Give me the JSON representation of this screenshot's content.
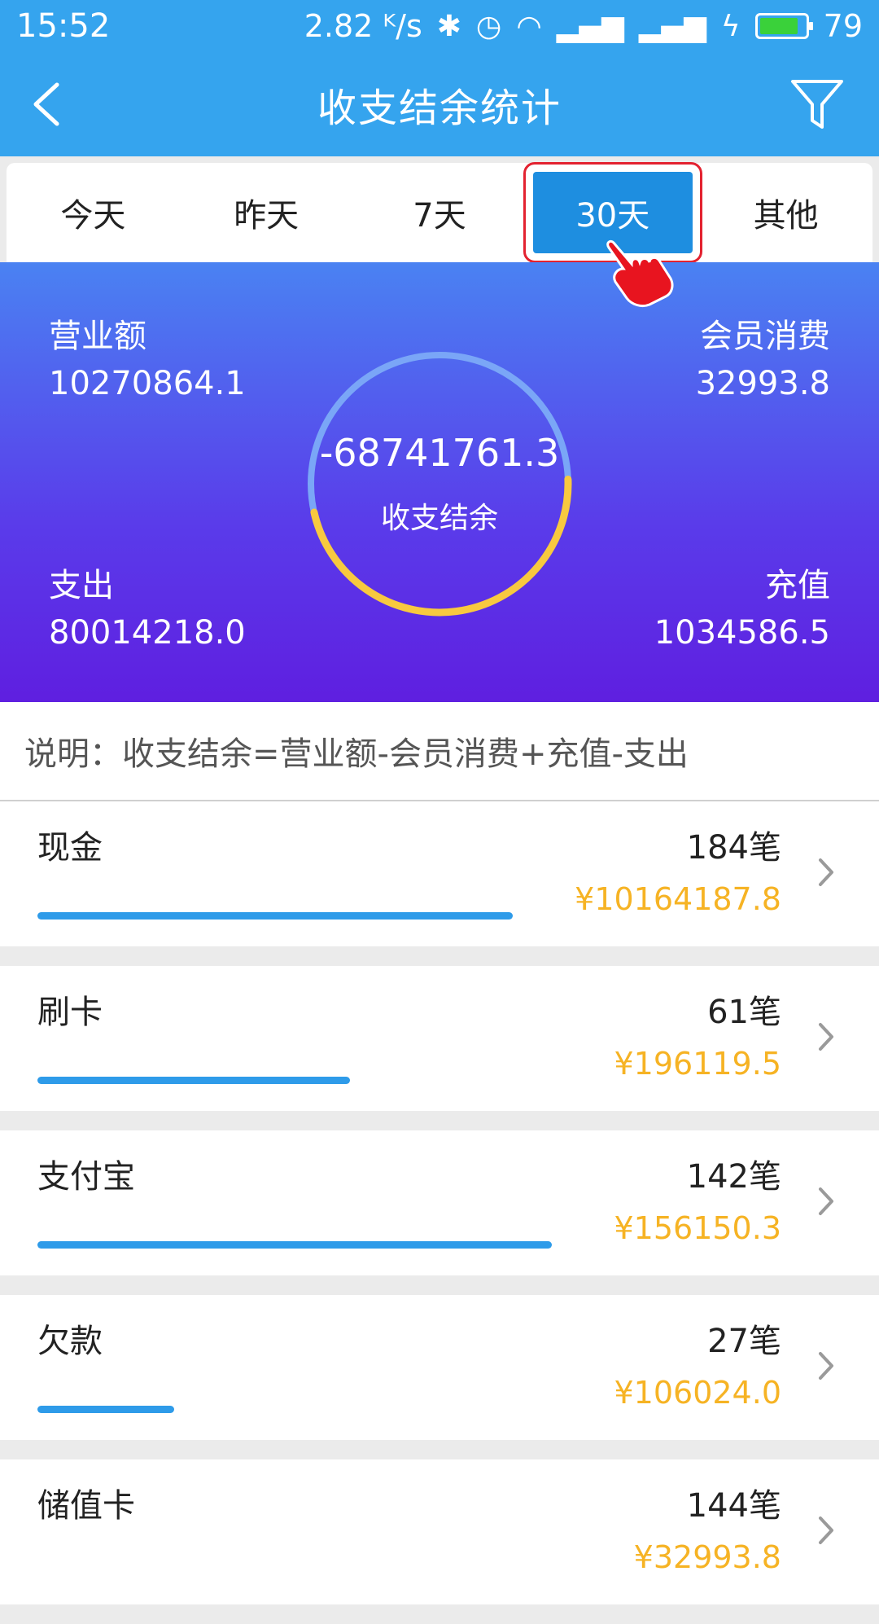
{
  "status_bar": {
    "time": "15:52",
    "speed": "2.82 ᴷ/s",
    "battery": "79",
    "icons": [
      "bluetooth-icon",
      "alarm-icon",
      "wifi-icon",
      "signal-icon",
      "signal-4g-icon",
      "charging-icon",
      "battery-icon"
    ]
  },
  "header": {
    "title": "收支结余统计"
  },
  "tabs": [
    {
      "label": "今天"
    },
    {
      "label": "昨天"
    },
    {
      "label": "7天"
    },
    {
      "label": "30天",
      "active": true
    },
    {
      "label": "其他"
    }
  ],
  "summary": {
    "revenue_label": "营业额",
    "revenue_value": "10270864.1",
    "member_label": "会员消费",
    "member_value": "32993.8",
    "expense_label": "支出",
    "expense_value": "80014218.0",
    "recharge_label": "充值",
    "recharge_value": "1034586.5",
    "balance_value": "-68741761.3",
    "balance_label": "收支结余",
    "ring_fraction_yellow": 0.47
  },
  "note": "说明：收支结余=营业额-会员消费+充值-支出",
  "rows": [
    {
      "name": "现金",
      "count": "184笔",
      "amount": "¥10164187.8",
      "progress": 0.73
    },
    {
      "name": "刷卡",
      "count": "61笔",
      "amount": "¥196119.5",
      "progress": 0.48
    },
    {
      "name": "支付宝",
      "count": "142笔",
      "amount": "¥156150.3",
      "progress": 0.79
    },
    {
      "name": "欠款",
      "count": "27笔",
      "amount": "¥106024.0",
      "progress": 0.21
    },
    {
      "name": "储值卡",
      "count": "144笔",
      "amount": "¥32993.8",
      "progress": 0.0
    }
  ],
  "colors": {
    "primary": "#35a4ee",
    "tab_active": "#1e8ee0",
    "highlight": "#e32230",
    "amount": "#f6b324",
    "bar": "#2e9be9"
  }
}
